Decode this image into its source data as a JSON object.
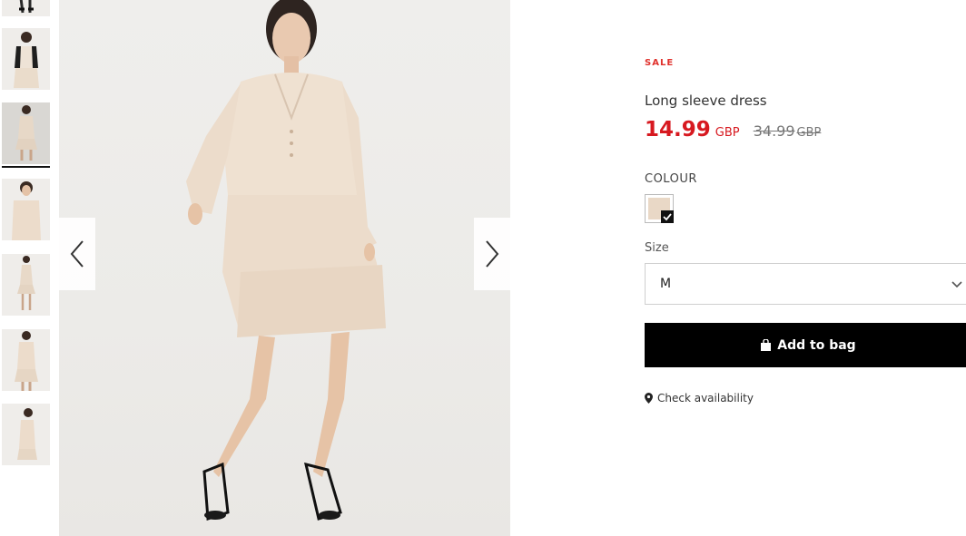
{
  "thumbnails": [
    {
      "name": "thumbnail-1",
      "selected": false
    },
    {
      "name": "thumbnail-2",
      "selected": false
    },
    {
      "name": "thumbnail-3",
      "selected": true
    },
    {
      "name": "thumbnail-4",
      "selected": false
    },
    {
      "name": "thumbnail-5",
      "selected": false
    },
    {
      "name": "thumbnail-6",
      "selected": false
    },
    {
      "name": "thumbnail-7",
      "selected": false
    }
  ],
  "gallery": {
    "prev_icon": "chevron-left-icon",
    "next_icon": "chevron-right-icon"
  },
  "product": {
    "badge": "SALE",
    "name": "Long sleeve dress",
    "price_now": "14.99",
    "price_now_currency": "GBP",
    "price_old": "34.99",
    "price_old_currency": "GBP"
  },
  "colour": {
    "label": "COLOUR",
    "selected_swatch": "#e9d8c6"
  },
  "size": {
    "label": "Size",
    "selected": "M"
  },
  "actions": {
    "add_to_bag": "Add to bag",
    "check_availability": "Check availability"
  },
  "colors": {
    "sale": "#e0312c",
    "price": "#d71920",
    "button_bg": "#000000"
  }
}
